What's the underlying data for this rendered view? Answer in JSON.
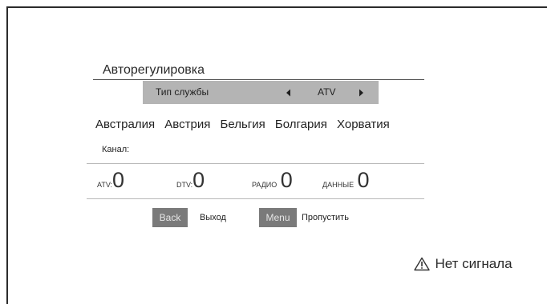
{
  "screen": {
    "title": "Авторегулировка"
  },
  "service_type": {
    "label": "Тип службы",
    "value": "ATV",
    "prev_icon": "arrow-left-icon",
    "next_icon": "arrow-right-icon"
  },
  "countries": [
    "Австралия",
    "Австрия",
    "Бельгия",
    "Болгария",
    "Хорватия"
  ],
  "channel": {
    "label": "Канал:"
  },
  "counters": {
    "atv": {
      "label": "ATV:",
      "value": "0"
    },
    "dtv": {
      "label": "DTV:",
      "value": "0"
    },
    "radio": {
      "label": "РАДИО",
      "value": "0"
    },
    "data": {
      "label": "ДАННЫЕ",
      "value": "0"
    }
  },
  "keys": {
    "back": {
      "key": "Back",
      "caption": "Выход"
    },
    "menu": {
      "key": "Menu",
      "caption": "Пропустить"
    }
  },
  "status": {
    "icon": "warning-icon",
    "text": "Нет сигнала"
  },
  "colors": {
    "service_bar": "#b4b4b4",
    "key_bg": "#7a7a7a",
    "key_text": "#e6e6e6"
  }
}
